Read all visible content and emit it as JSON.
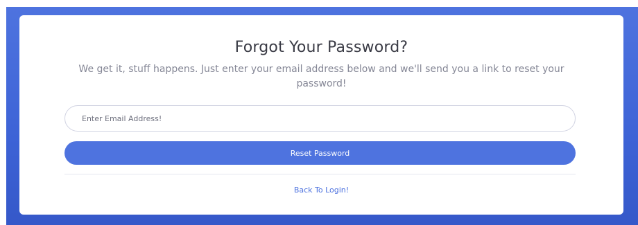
{
  "card": {
    "title": "Forgot Your Password?",
    "subtitle": "We get it, stuff happens. Just enter your email address below and we'll send you a link to reset your password!"
  },
  "form": {
    "email_placeholder": "Enter Email Address!",
    "email_value": "",
    "reset_label": "Reset Password"
  },
  "footer": {
    "back_link": "Back To Login!"
  },
  "colors": {
    "primary": "#4e73df",
    "background": "#4e73df",
    "title_text": "#3a3b45",
    "muted_text": "#858796"
  }
}
